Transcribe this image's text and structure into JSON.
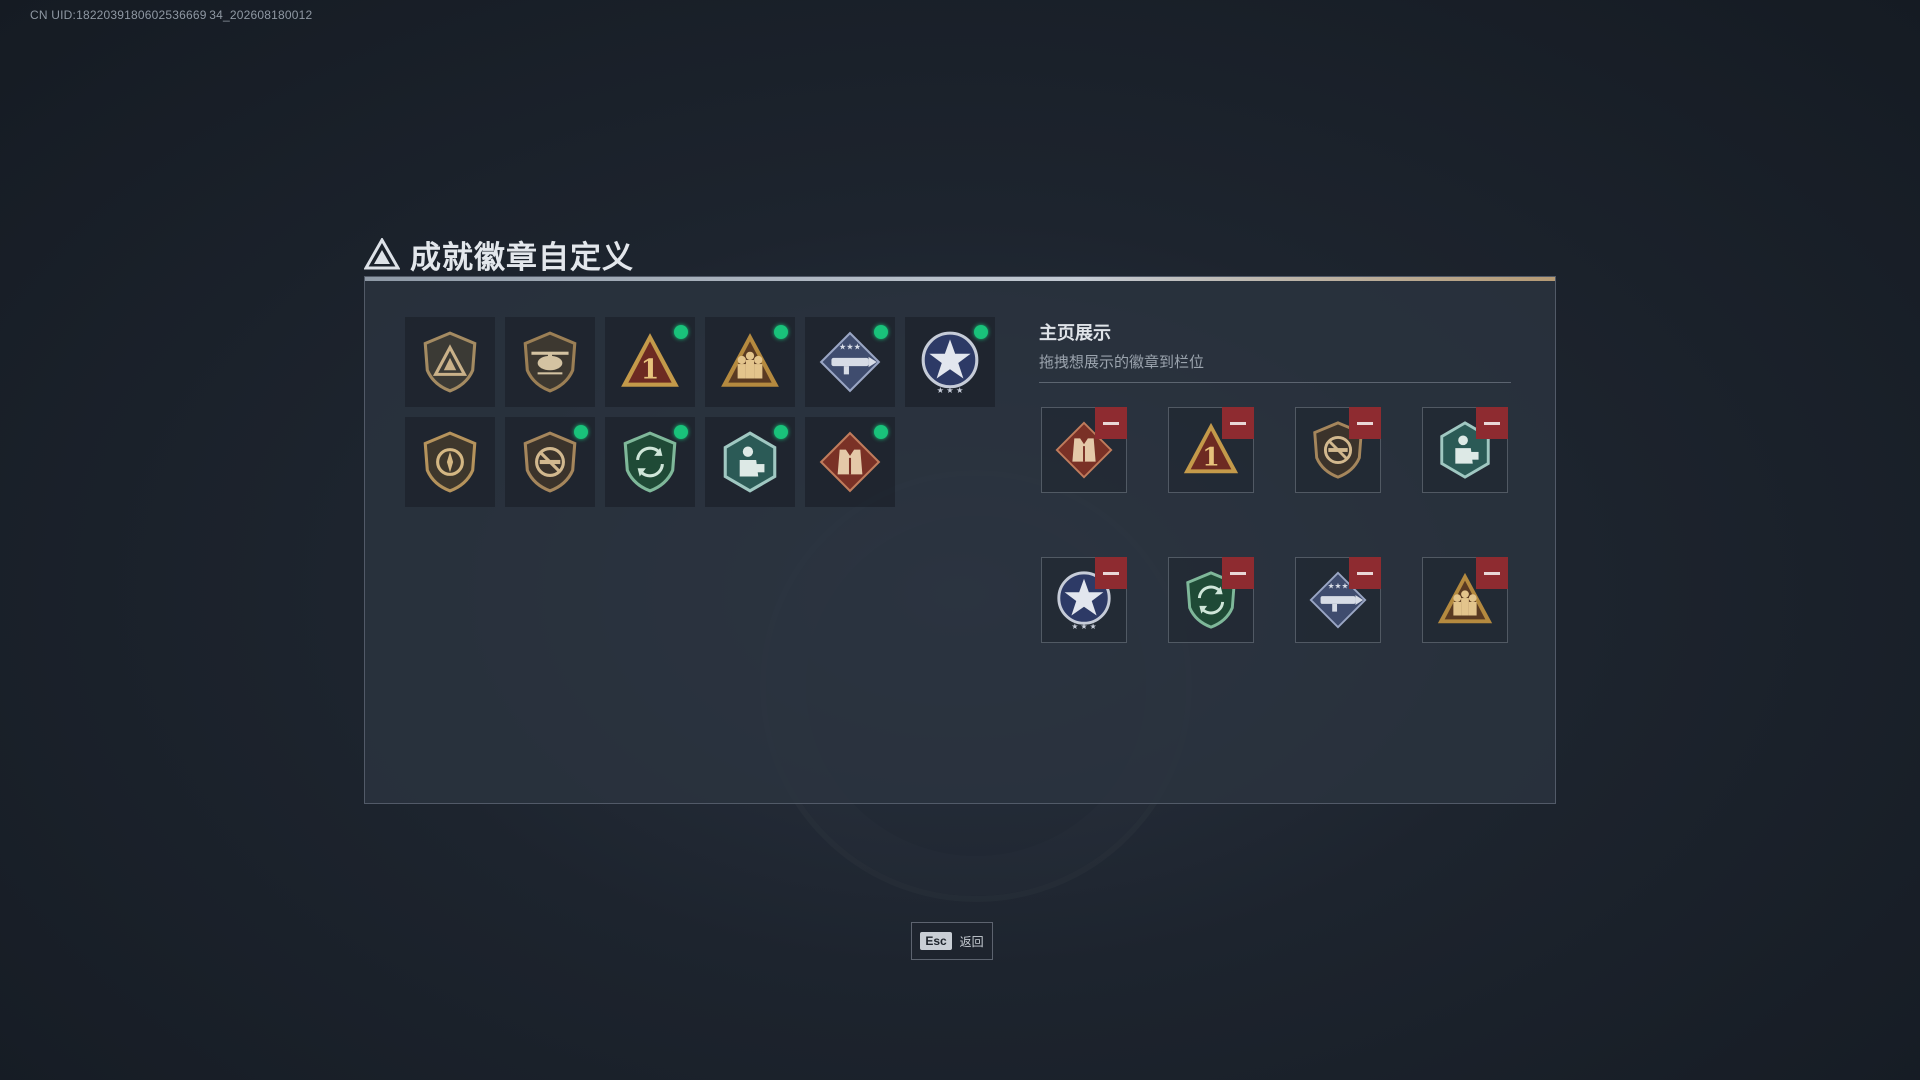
{
  "uid": "CN UID:1822039180602536669 34_202608180012",
  "title": "成就徽章自定义",
  "collection": {
    "badges": [
      {
        "icon": "delta-shield-badge-icon",
        "new": false
      },
      {
        "icon": "helicopter-shield-badge-icon",
        "new": false
      },
      {
        "icon": "number-one-triangle-badge-icon",
        "new": true
      },
      {
        "icon": "soldiers-triangle-badge-icon",
        "new": true
      },
      {
        "icon": "rocket-launcher-diamond-badge-icon",
        "new": true
      },
      {
        "icon": "star-wreath-badge-icon",
        "new": true
      },
      {
        "icon": "compass-shield-badge-icon",
        "new": false
      },
      {
        "icon": "no-firearms-shield-badge-icon",
        "new": true
      },
      {
        "icon": "green-cycle-shield-badge-icon",
        "new": true
      },
      {
        "icon": "medic-hexagon-badge-icon",
        "new": true
      },
      {
        "icon": "vest-diamond-badge-icon",
        "new": true
      }
    ]
  },
  "showcase": {
    "heading": "主页展示",
    "hint": "拖拽想展示的徽章到栏位",
    "slots": [
      {
        "icon": "vest-diamond-badge-icon"
      },
      {
        "icon": "number-one-triangle-badge-icon"
      },
      {
        "icon": "no-firearms-shield-badge-icon"
      },
      {
        "icon": "medic-hexagon-badge-icon"
      },
      {
        "icon": "star-wreath-badge-icon"
      },
      {
        "icon": "green-cycle-shield-badge-icon"
      },
      {
        "icon": "rocket-launcher-diamond-badge-icon"
      },
      {
        "icon": "soldiers-triangle-badge-icon"
      }
    ]
  },
  "footer": {
    "esc_key": "Esc",
    "back_label": "返回"
  },
  "colors": {
    "new_dot": "#19c27a",
    "remove": "#8e2b30",
    "accent_gold": "#b59a74"
  }
}
